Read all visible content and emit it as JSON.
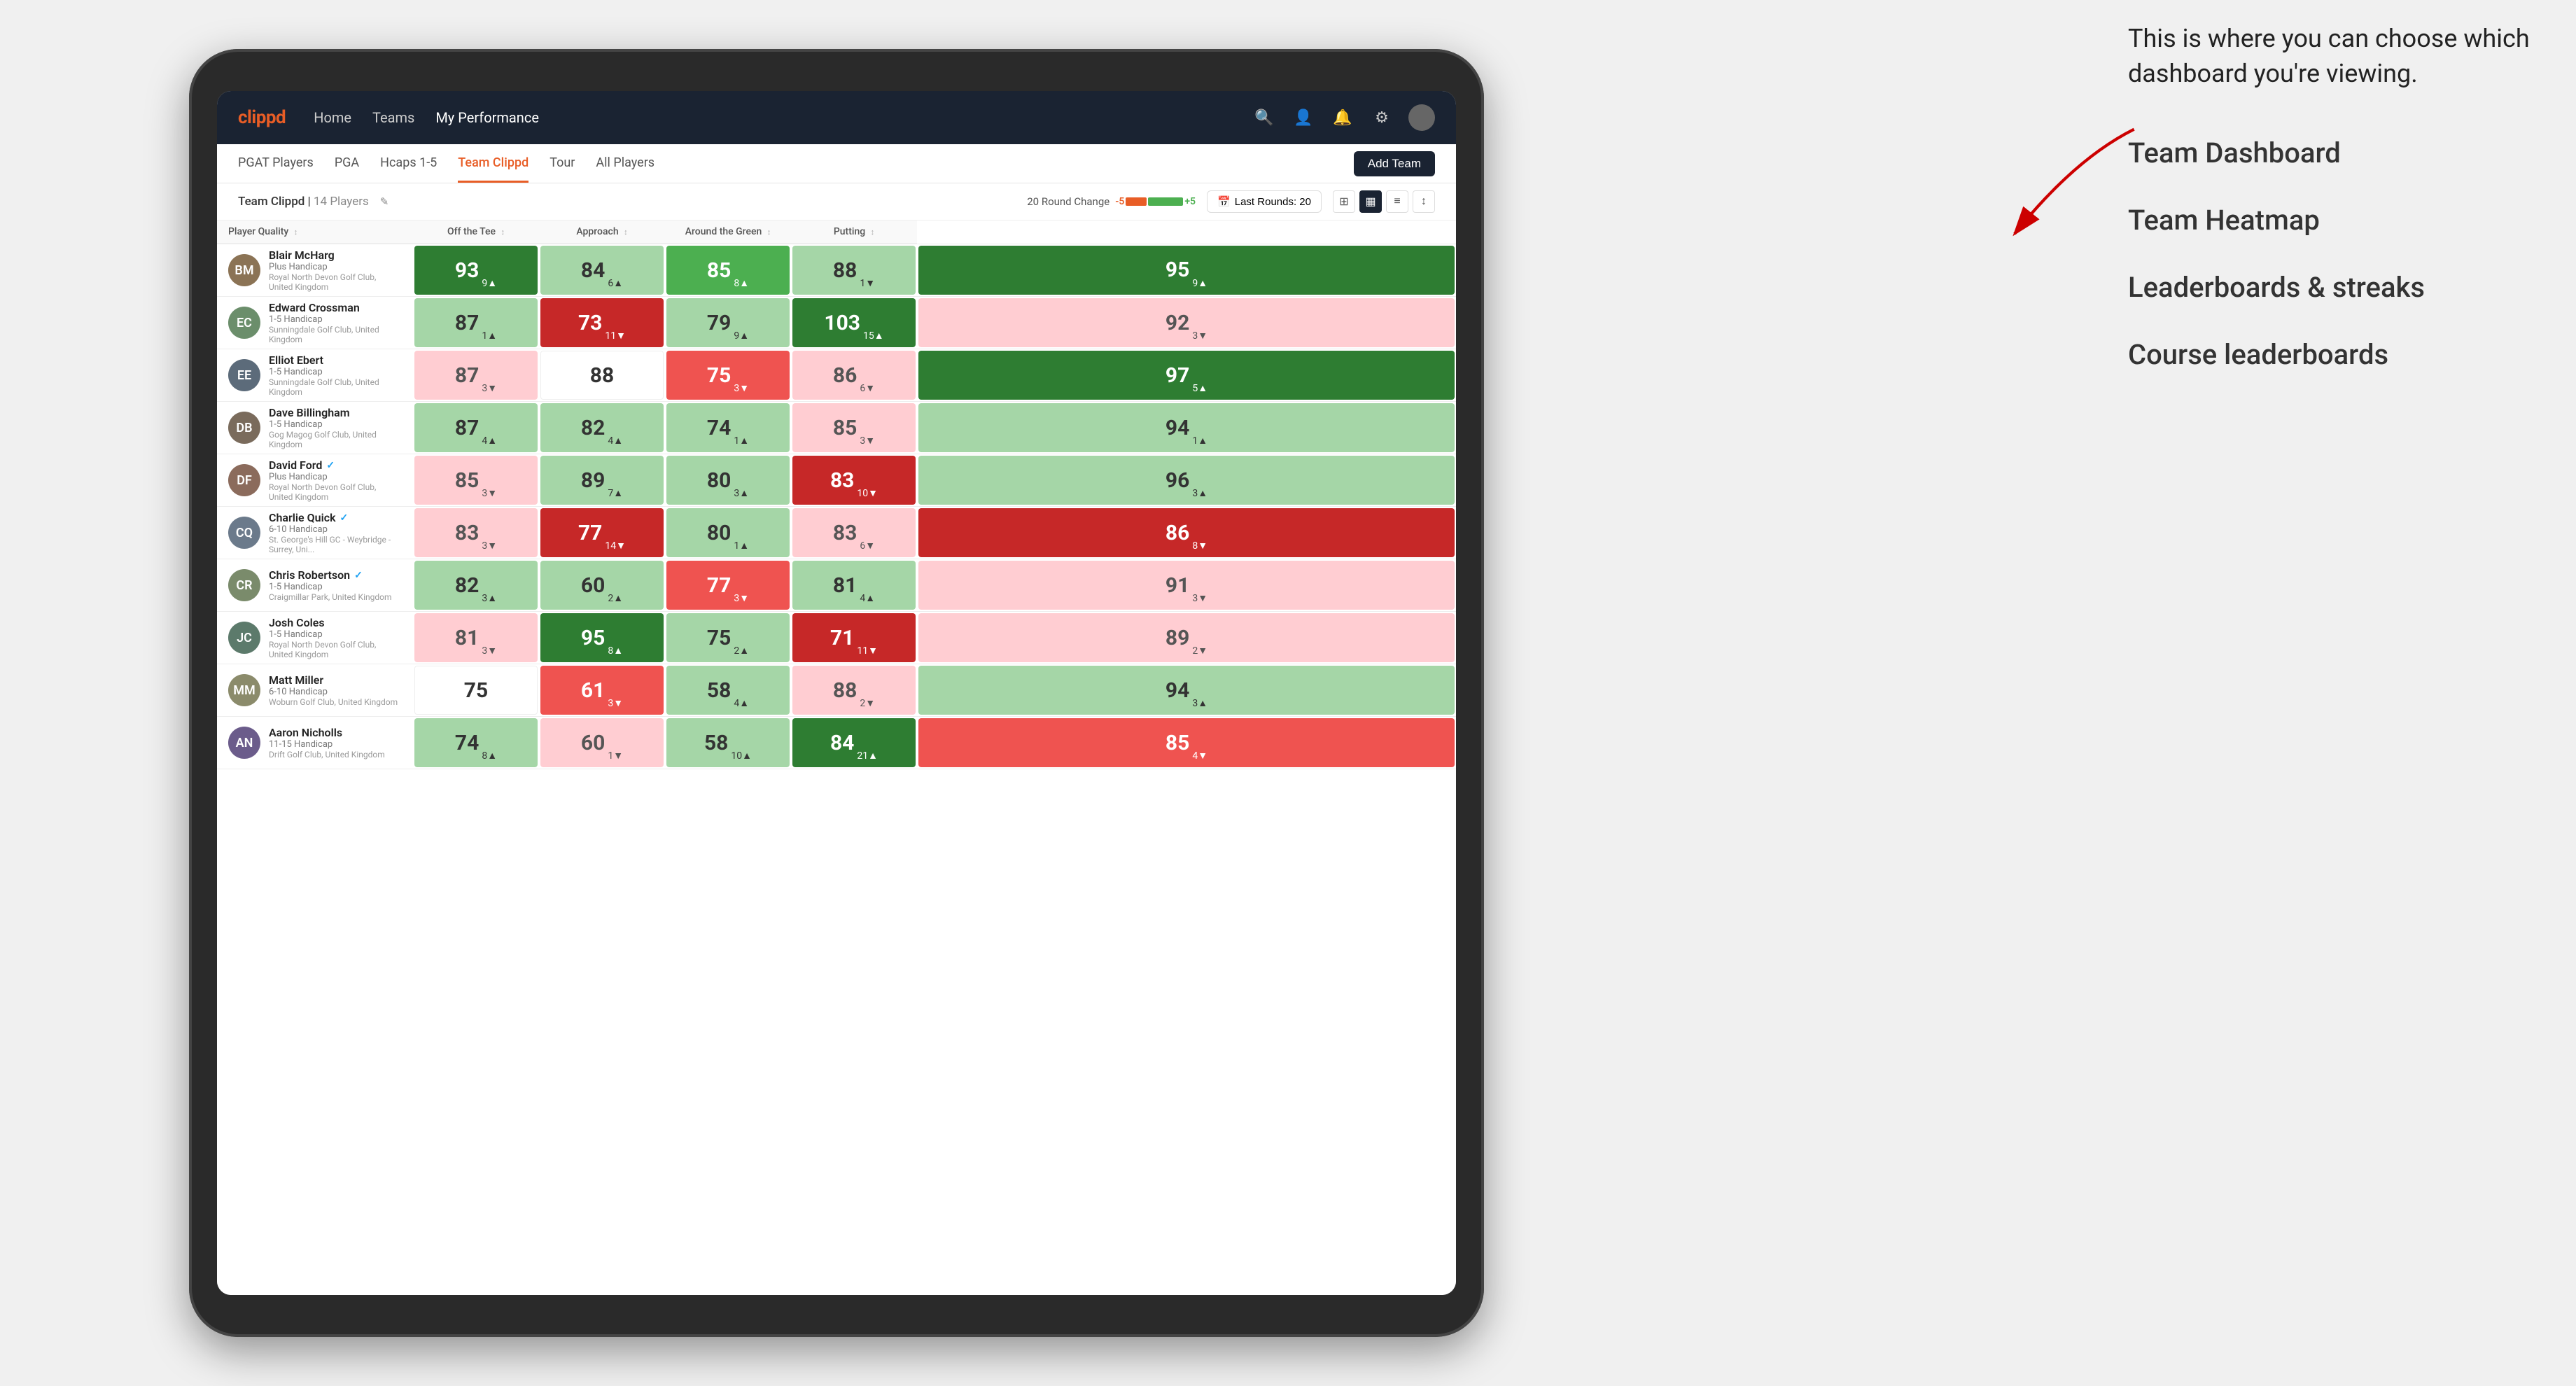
{
  "annotation": {
    "intro": "This is where you can choose which dashboard you're viewing.",
    "items": [
      "Team Dashboard",
      "Team Heatmap",
      "Leaderboards & streaks",
      "Course leaderboards"
    ]
  },
  "nav": {
    "logo": "clippd",
    "links": [
      "Home",
      "Teams",
      "My Performance"
    ],
    "active": "My Performance"
  },
  "sub_nav": {
    "links": [
      "PGAT Players",
      "PGA",
      "Hcaps 1-5",
      "Team Clippd",
      "Tour",
      "All Players"
    ],
    "active": "Team Clippd",
    "add_team_label": "Add Team"
  },
  "team_header": {
    "team_name": "Team Clippd",
    "player_count": "14 Players",
    "round_change_label": "20 Round Change",
    "change_minus": "-5",
    "change_plus": "+5",
    "last_rounds_label": "Last Rounds:",
    "last_rounds_value": "20"
  },
  "table": {
    "columns": [
      "Player Quality ↕",
      "Off the Tee ↕",
      "Approach ↕",
      "Around the Green ↕",
      "Putting ↕"
    ],
    "players": [
      {
        "name": "Blair McHarg",
        "handicap": "Plus Handicap",
        "club": "Royal North Devon Golf Club, United Kingdom",
        "initials": "BM",
        "avatar_color": "#8B7355",
        "scores": [
          {
            "value": 93,
            "change": 9,
            "dir": "up",
            "color": "green-dark"
          },
          {
            "value": 84,
            "change": 6,
            "dir": "up",
            "color": "green-light"
          },
          {
            "value": 85,
            "change": 8,
            "dir": "up",
            "color": "green-mid"
          },
          {
            "value": 88,
            "change": 1,
            "dir": "down",
            "color": "green-light"
          },
          {
            "value": 95,
            "change": 9,
            "dir": "up",
            "color": "green-dark"
          }
        ]
      },
      {
        "name": "Edward Crossman",
        "handicap": "1-5 Handicap",
        "club": "Sunningdale Golf Club, United Kingdom",
        "initials": "EC",
        "avatar_color": "#6B8E6B",
        "scores": [
          {
            "value": 87,
            "change": 1,
            "dir": "up",
            "color": "green-light"
          },
          {
            "value": 73,
            "change": 11,
            "dir": "down",
            "color": "red-dark"
          },
          {
            "value": 79,
            "change": 9,
            "dir": "up",
            "color": "green-light"
          },
          {
            "value": 103,
            "change": 15,
            "dir": "up",
            "color": "green-dark"
          },
          {
            "value": 92,
            "change": 3,
            "dir": "down",
            "color": "red-light"
          }
        ]
      },
      {
        "name": "Elliot Ebert",
        "handicap": "1-5 Handicap",
        "club": "Sunningdale Golf Club, United Kingdom",
        "initials": "EE",
        "avatar_color": "#5C6B7A",
        "scores": [
          {
            "value": 87,
            "change": 3,
            "dir": "down",
            "color": "red-light"
          },
          {
            "value": 88,
            "change": null,
            "dir": null,
            "color": "neutral"
          },
          {
            "value": 75,
            "change": 3,
            "dir": "down",
            "color": "red-mid"
          },
          {
            "value": 86,
            "change": 6,
            "dir": "down",
            "color": "red-light"
          },
          {
            "value": 97,
            "change": 5,
            "dir": "up",
            "color": "green-dark"
          }
        ]
      },
      {
        "name": "Dave Billingham",
        "handicap": "1-5 Handicap",
        "club": "Gog Magog Golf Club, United Kingdom",
        "initials": "DB",
        "avatar_color": "#7A6B5C",
        "scores": [
          {
            "value": 87,
            "change": 4,
            "dir": "up",
            "color": "green-light"
          },
          {
            "value": 82,
            "change": 4,
            "dir": "up",
            "color": "green-light"
          },
          {
            "value": 74,
            "change": 1,
            "dir": "up",
            "color": "green-light"
          },
          {
            "value": 85,
            "change": 3,
            "dir": "down",
            "color": "red-light"
          },
          {
            "value": 94,
            "change": 1,
            "dir": "up",
            "color": "green-light"
          }
        ]
      },
      {
        "name": "David Ford",
        "verified": true,
        "handicap": "Plus Handicap",
        "club": "Royal North Devon Golf Club, United Kingdom",
        "initials": "DF",
        "avatar_color": "#8B6B5C",
        "scores": [
          {
            "value": 85,
            "change": 3,
            "dir": "down",
            "color": "red-light"
          },
          {
            "value": 89,
            "change": 7,
            "dir": "up",
            "color": "green-light"
          },
          {
            "value": 80,
            "change": 3,
            "dir": "up",
            "color": "green-light"
          },
          {
            "value": 83,
            "change": 10,
            "dir": "down",
            "color": "red-dark"
          },
          {
            "value": 96,
            "change": 3,
            "dir": "up",
            "color": "green-light"
          }
        ]
      },
      {
        "name": "Charlie Quick",
        "verified": true,
        "handicap": "6-10 Handicap",
        "club": "St. George's Hill GC - Weybridge - Surrey, Uni...",
        "initials": "CQ",
        "avatar_color": "#6B7A8B",
        "scores": [
          {
            "value": 83,
            "change": 3,
            "dir": "down",
            "color": "red-light"
          },
          {
            "value": 77,
            "change": 14,
            "dir": "down",
            "color": "red-dark"
          },
          {
            "value": 80,
            "change": 1,
            "dir": "up",
            "color": "green-light"
          },
          {
            "value": 83,
            "change": 6,
            "dir": "down",
            "color": "red-light"
          },
          {
            "value": 86,
            "change": 8,
            "dir": "down",
            "color": "red-dark"
          }
        ]
      },
      {
        "name": "Chris Robertson",
        "verified": true,
        "handicap": "1-5 Handicap",
        "club": "Craigmillar Park, United Kingdom",
        "initials": "CR",
        "avatar_color": "#7A8B6B",
        "scores": [
          {
            "value": 82,
            "change": 3,
            "dir": "up",
            "color": "green-light"
          },
          {
            "value": 60,
            "change": 2,
            "dir": "up",
            "color": "green-light"
          },
          {
            "value": 77,
            "change": 3,
            "dir": "down",
            "color": "red-mid"
          },
          {
            "value": 81,
            "change": 4,
            "dir": "up",
            "color": "green-light"
          },
          {
            "value": 91,
            "change": 3,
            "dir": "down",
            "color": "red-light"
          }
        ]
      },
      {
        "name": "Josh Coles",
        "handicap": "1-5 Handicap",
        "club": "Royal North Devon Golf Club, United Kingdom",
        "initials": "JC",
        "avatar_color": "#5C7A6B",
        "scores": [
          {
            "value": 81,
            "change": 3,
            "dir": "down",
            "color": "red-light"
          },
          {
            "value": 95,
            "change": 8,
            "dir": "up",
            "color": "green-dark"
          },
          {
            "value": 75,
            "change": 2,
            "dir": "up",
            "color": "green-light"
          },
          {
            "value": 71,
            "change": 11,
            "dir": "down",
            "color": "red-dark"
          },
          {
            "value": 89,
            "change": 2,
            "dir": "down",
            "color": "red-light"
          }
        ]
      },
      {
        "name": "Matt Miller",
        "handicap": "6-10 Handicap",
        "club": "Woburn Golf Club, United Kingdom",
        "initials": "MM",
        "avatar_color": "#8B8B6B",
        "scores": [
          {
            "value": 75,
            "change": null,
            "dir": null,
            "color": "neutral"
          },
          {
            "value": 61,
            "change": 3,
            "dir": "down",
            "color": "red-mid"
          },
          {
            "value": 58,
            "change": 4,
            "dir": "up",
            "color": "green-light"
          },
          {
            "value": 88,
            "change": 2,
            "dir": "down",
            "color": "red-light"
          },
          {
            "value": 94,
            "change": 3,
            "dir": "up",
            "color": "green-light"
          }
        ]
      },
      {
        "name": "Aaron Nicholls",
        "handicap": "11-15 Handicap",
        "club": "Drift Golf Club, United Kingdom",
        "initials": "AN",
        "avatar_color": "#6B5C8B",
        "scores": [
          {
            "value": 74,
            "change": 8,
            "dir": "up",
            "color": "green-light"
          },
          {
            "value": 60,
            "change": 1,
            "dir": "down",
            "color": "red-light"
          },
          {
            "value": 58,
            "change": 10,
            "dir": "up",
            "color": "green-light"
          },
          {
            "value": 84,
            "change": 21,
            "dir": "up",
            "color": "green-dark"
          },
          {
            "value": 85,
            "change": 4,
            "dir": "down",
            "color": "red-mid"
          }
        ]
      }
    ]
  }
}
